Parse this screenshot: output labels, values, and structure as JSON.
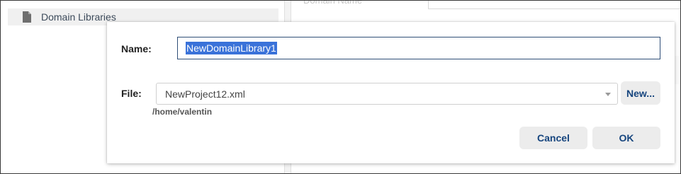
{
  "background": {
    "tree_item_label": "Domain Libraries",
    "tree_item_icon": "file-icon",
    "right_header_text": "Domain Name"
  },
  "dialog": {
    "name_label": "Name:",
    "name_value": "NewDomainLibrary1",
    "file_label": "File:",
    "file_value": "NewProject12.xml",
    "new_button": "New...",
    "file_path": "/home/valentin",
    "cancel_button": "Cancel",
    "ok_button": "OK"
  },
  "colors": {
    "accent_text": "#16457e",
    "selection": "#3a72d9",
    "focus_border": "#2f4e77",
    "orange_marker": "#f28c28"
  }
}
